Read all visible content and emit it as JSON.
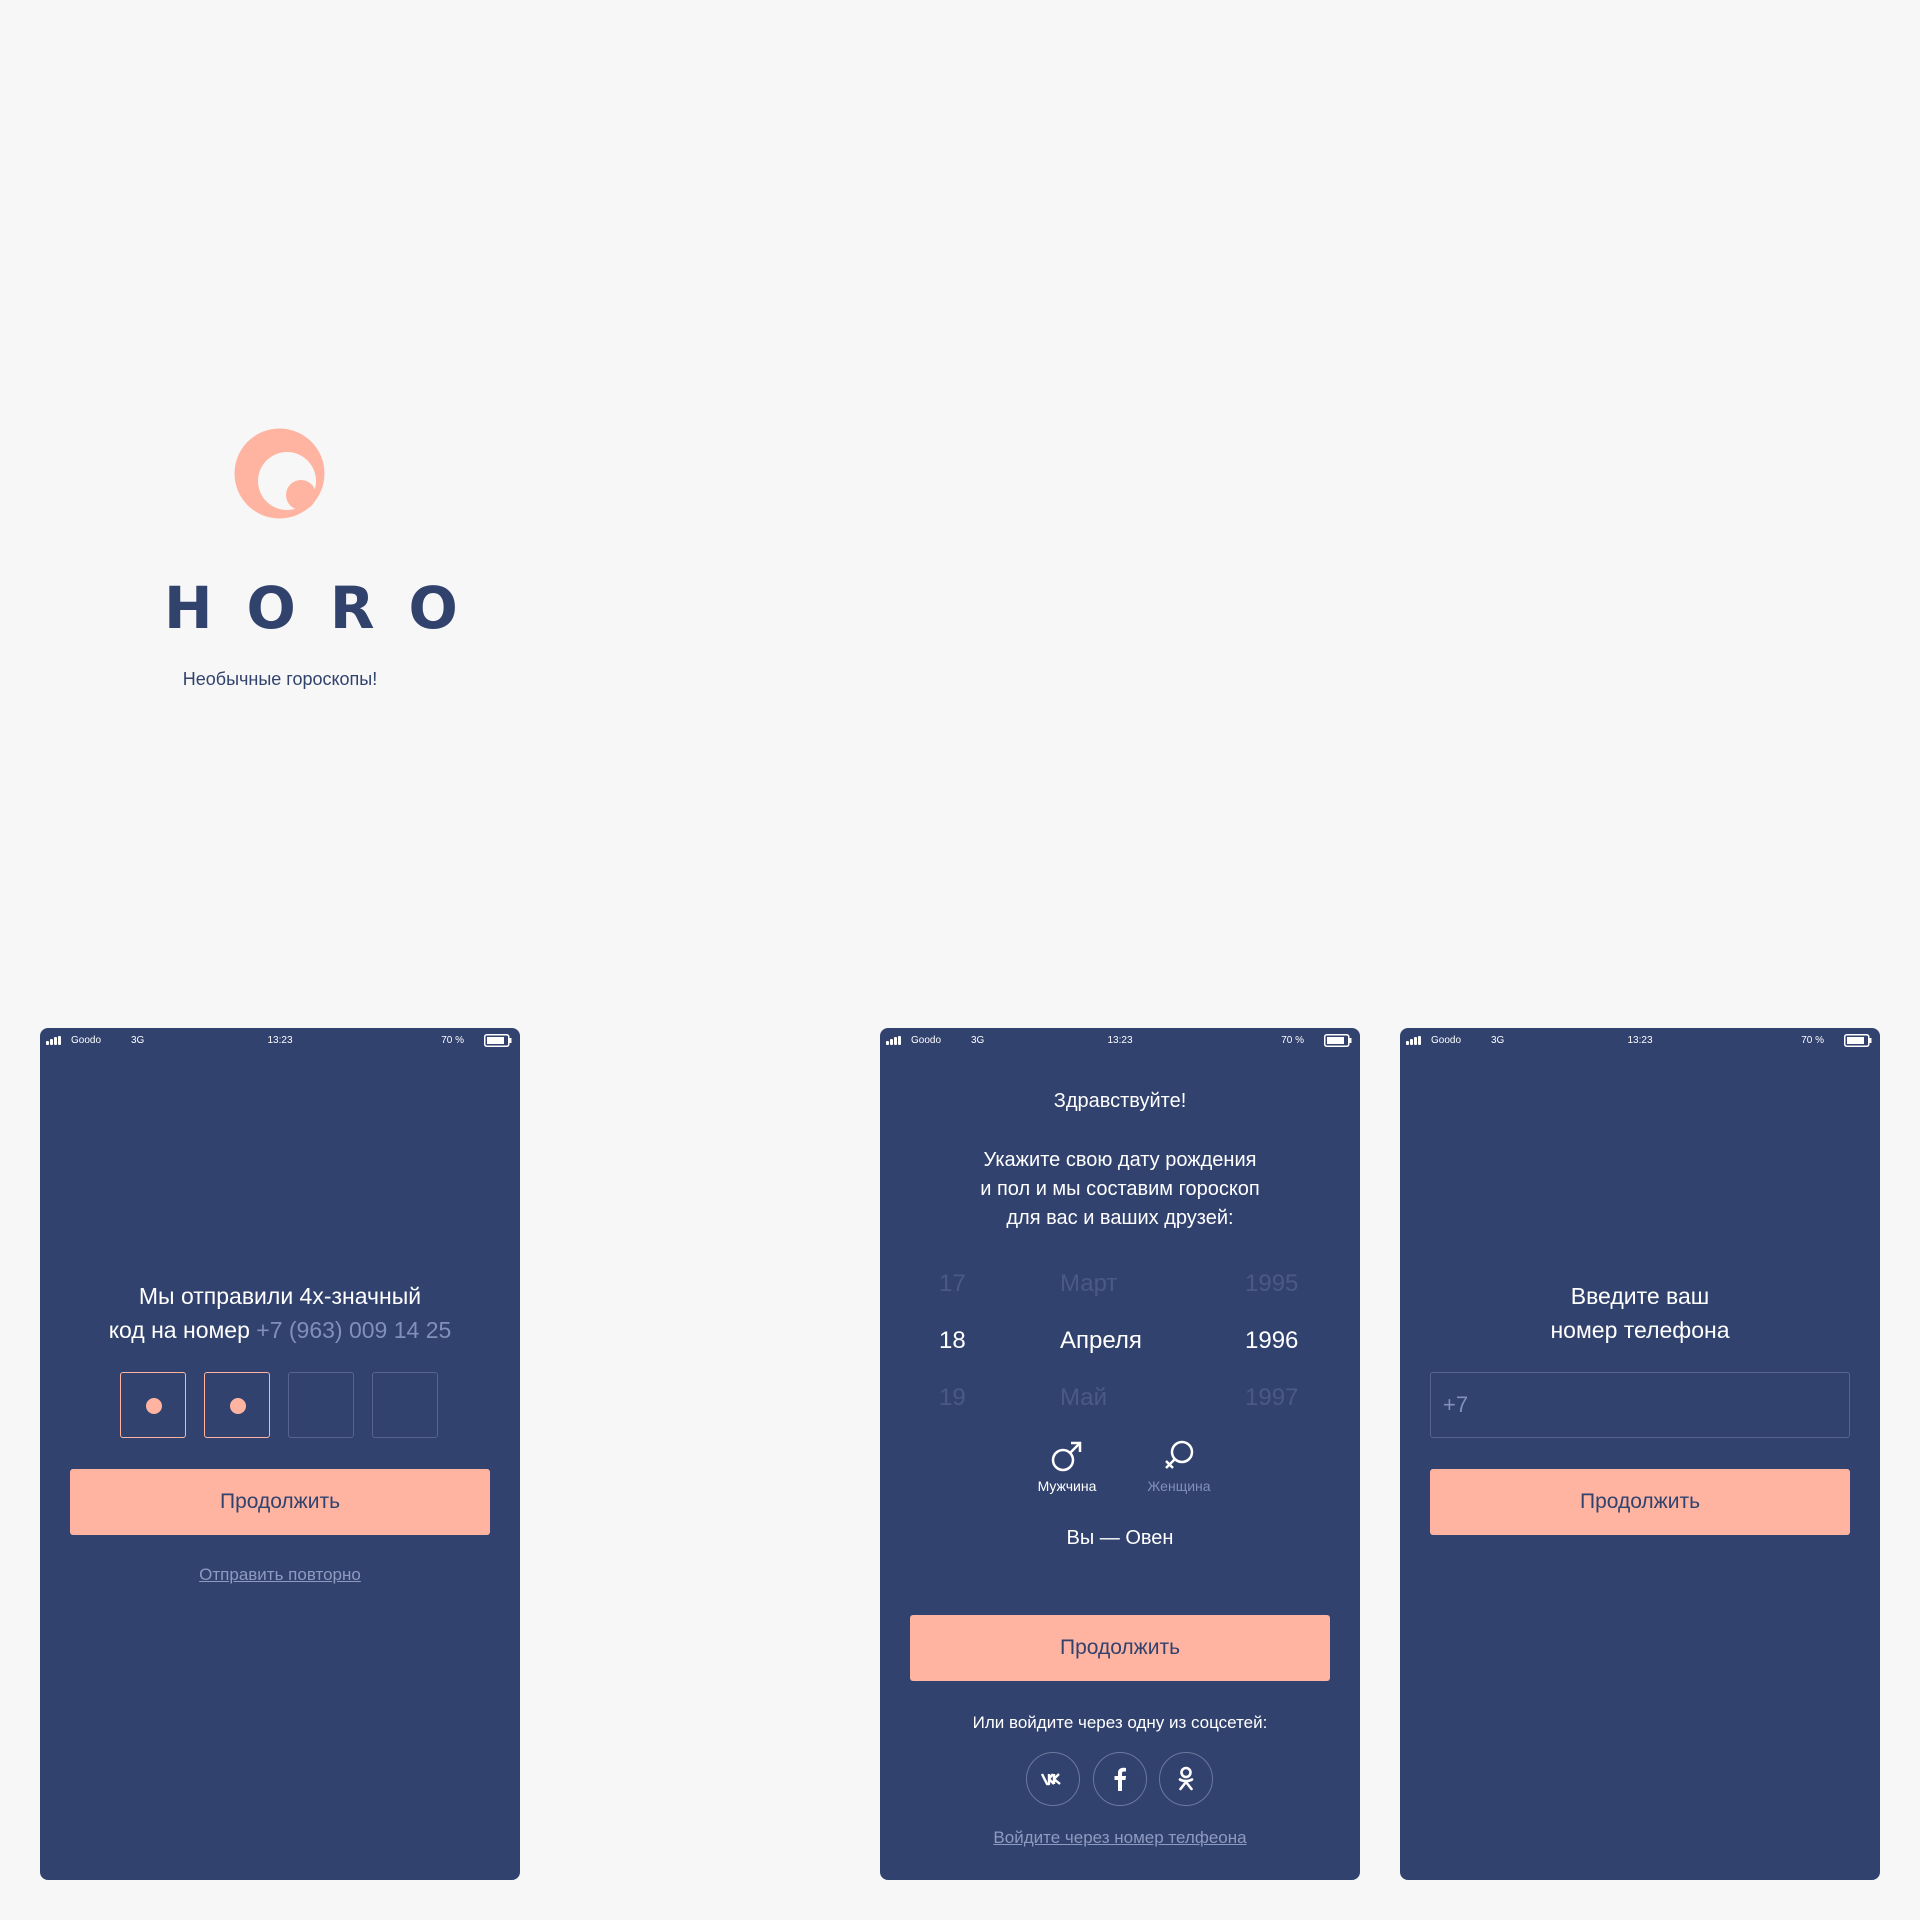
{
  "brand": {
    "title": "HORO",
    "tagline": "Необычные гороскопы!",
    "accent": "#ffb4a2",
    "navy": "#31426d"
  },
  "statusbar": {
    "carrier": "Goodo",
    "network": "3G",
    "time": "13:23",
    "battery": "70 %"
  },
  "code_screen": {
    "line1": "Мы отправили 4х-значный",
    "line2_prefix": "код на номер ",
    "phone": "+7 (963) 009 14 25",
    "continue": "Продолжить",
    "resend": "Отправить повторно"
  },
  "birth_screen": {
    "greeting": "Здравствуйте!",
    "text1": "Укажите свою дату рождения",
    "text2": "и пол и мы составим гороскоп",
    "text3": "для вас и ваших друзей:",
    "day": {
      "prev": "17",
      "current": "18",
      "next": "19"
    },
    "month": {
      "prev": "Март",
      "current": "Апреля",
      "next": "Май"
    },
    "year": {
      "prev": "1995",
      "current": "1996",
      "next": "1997"
    },
    "male": "Мужчина",
    "female": "Женщина",
    "sign": "Вы — Овен",
    "continue": "Продолжить",
    "social_text": "Или войдите через одну из соцсетей:",
    "social_icons": [
      "vk-icon",
      "facebook-icon",
      "odnoklassniki-icon"
    ],
    "phone_login": "Войдите через номер телфеона"
  },
  "phone_screen": {
    "title1": "Введите ваш",
    "title2": "номер телефона",
    "placeholder": "+7",
    "continue": "Продолжить"
  }
}
